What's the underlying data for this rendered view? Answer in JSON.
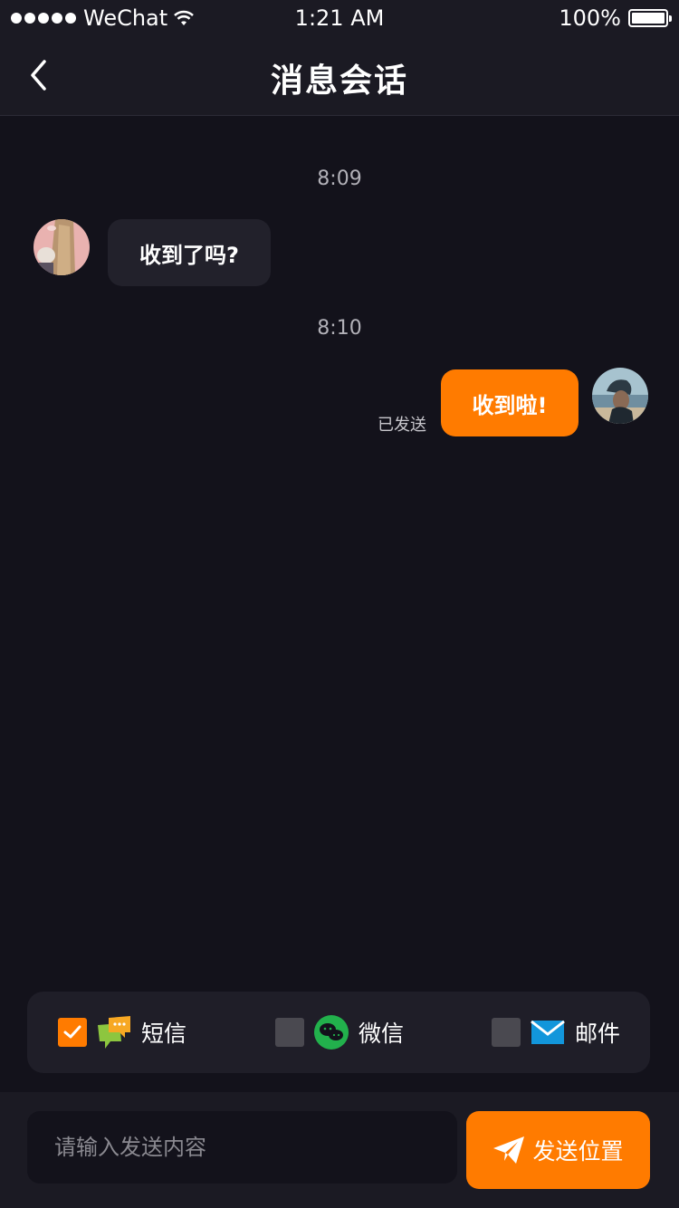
{
  "status_bar": {
    "carrier": "WeChat",
    "time": "1:21 AM",
    "battery": "100%"
  },
  "header": {
    "title": "消息会话"
  },
  "messages": [
    {
      "time": "8:09",
      "text": "收到了吗?",
      "direction": "incoming"
    },
    {
      "time": "8:10",
      "text": "收到啦!",
      "direction": "outgoing",
      "status": "已发送"
    }
  ],
  "channels": [
    {
      "label": "短信",
      "checked": true,
      "icon": "sms-icon"
    },
    {
      "label": "微信",
      "checked": false,
      "icon": "wechat-icon"
    },
    {
      "label": "邮件",
      "checked": false,
      "icon": "mail-icon"
    }
  ],
  "composer": {
    "placeholder": "请输入发送内容",
    "value": "",
    "send_label": "发送位置"
  },
  "colors": {
    "accent": "#ff7b00",
    "background": "#13121b",
    "bar": "#1b1a23",
    "incoming_bubble": "#22212b",
    "wechat_green": "#22b14c",
    "mail_blue": "#1296db"
  }
}
